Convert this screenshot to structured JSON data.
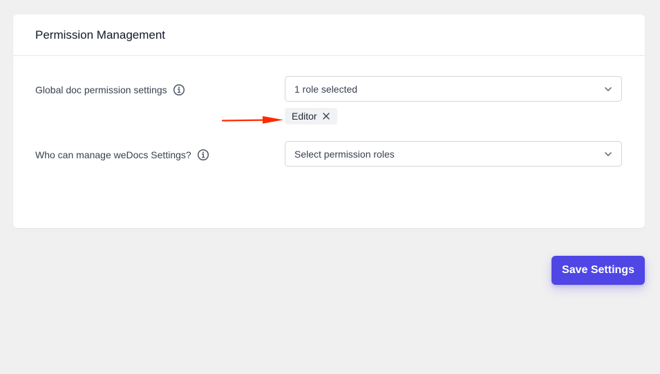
{
  "panel": {
    "title": "Permission Management"
  },
  "settings": [
    {
      "label": "Global doc permission settings",
      "select_value": "1 role selected",
      "selected_tags": [
        "Editor"
      ]
    },
    {
      "label": "Who can manage weDocs Settings?",
      "select_value": "Select permission roles",
      "selected_tags": []
    }
  ],
  "actions": {
    "save_label": "Save Settings"
  },
  "colors": {
    "accent": "#4f46e5",
    "annotation_arrow": "#ff2a00",
    "page_background": "#f0f0f1"
  },
  "icons": {
    "info": "info-circle-icon",
    "dropdown": "chevron-down-icon",
    "remove_tag": "close-icon",
    "annotation": "arrow-right-icon"
  }
}
